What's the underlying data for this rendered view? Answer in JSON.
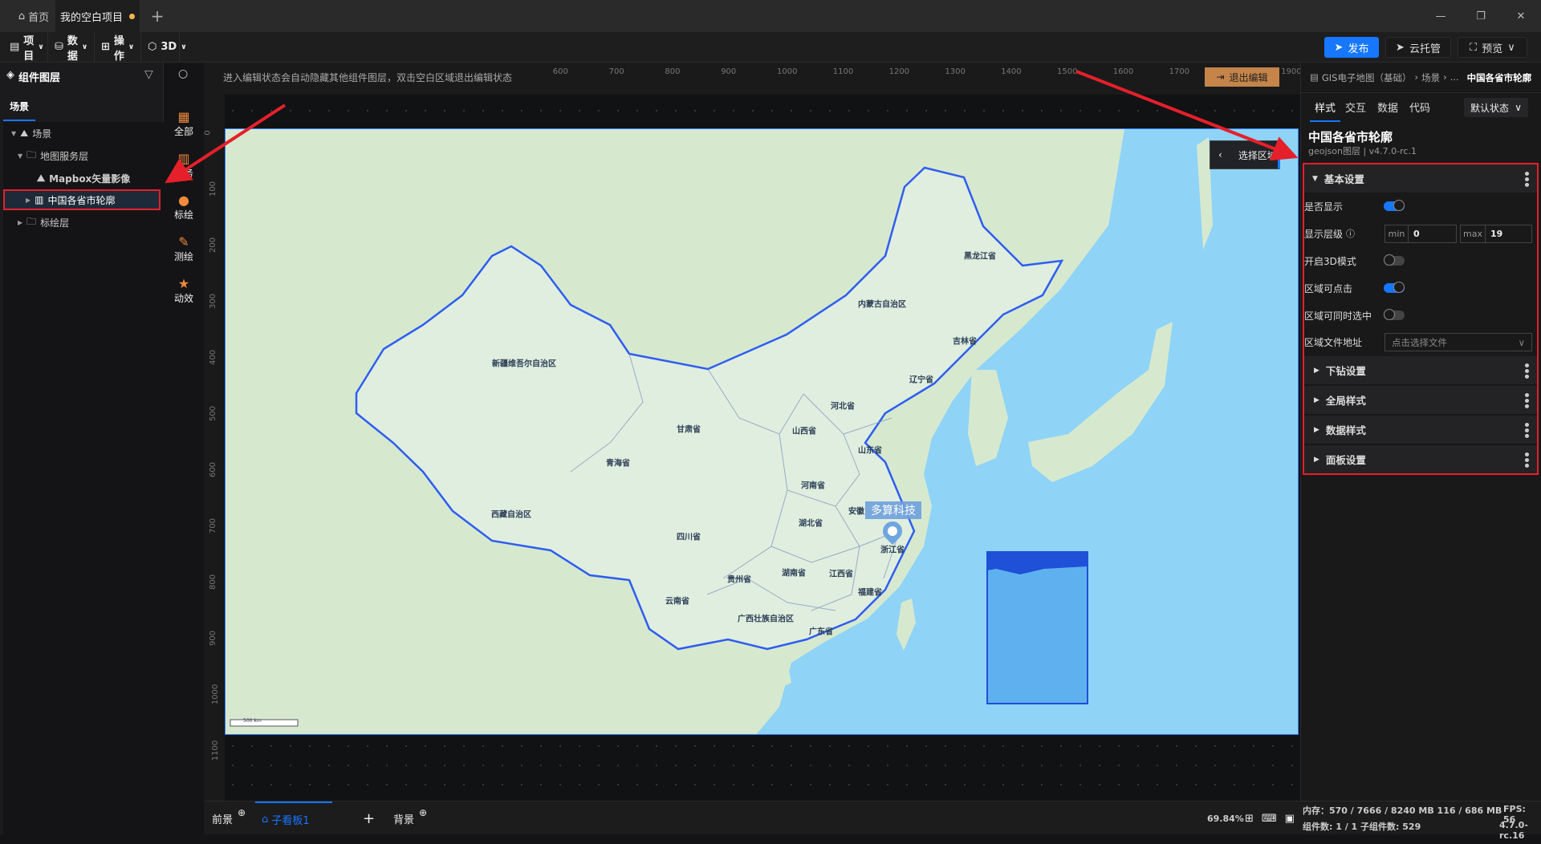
{
  "tabs": {
    "home": "首页",
    "project": "我的空白项目",
    "add": "+"
  },
  "window": {
    "minimize": "—",
    "restore": "❐",
    "close": "✕"
  },
  "toolbar": {
    "items": [
      {
        "label": "项目",
        "icon": "file-icon"
      },
      {
        "label": "数据",
        "icon": "database-icon"
      },
      {
        "label": "操作",
        "icon": "grid-icon"
      },
      {
        "label": "3D",
        "icon": "cube-icon"
      }
    ],
    "publish": "发布",
    "cloud": "云托管",
    "preview": "预览"
  },
  "left": {
    "title": "组件图层",
    "tab": "场景",
    "tree": [
      {
        "label": "场景"
      },
      {
        "label": "地图服务层"
      },
      {
        "label": "Mapbox矢量影像"
      },
      {
        "label": "中国各省市轮廓"
      },
      {
        "label": "标绘层"
      }
    ]
  },
  "iconbar": [
    {
      "label": "全部",
      "icon": "grid-icon"
    },
    {
      "label": "服务",
      "icon": "map-icon"
    },
    {
      "label": "标绘",
      "icon": "pin-icon"
    },
    {
      "label": "测绘",
      "icon": "ruler-pencil-icon"
    },
    {
      "label": "动效",
      "icon": "star-icon"
    }
  ],
  "canvas": {
    "hint": "进入编辑状态会自动隐藏其他组件图层，双击空白区域退出编辑状态",
    "exit_edit": "退出编辑",
    "select_region": "选择区域",
    "ruler_x": [
      "600",
      "700",
      "800",
      "900",
      "1000",
      "1100",
      "1200",
      "1300",
      "1400",
      "1500",
      "1600",
      "1700",
      "1800",
      "1900"
    ],
    "ruler_y": [
      "0",
      "100",
      "200",
      "300",
      "400",
      "500",
      "600",
      "700",
      "800",
      "900",
      "1000",
      "1100"
    ]
  },
  "map": {
    "marker_label": "多算科技",
    "scale": "500 km",
    "provinces": [
      "黑龙江省",
      "内蒙古自治区",
      "吉林省",
      "辽宁省",
      "河北省",
      "新疆维吾尔自治区",
      "甘肃省",
      "山西省",
      "山东省",
      "青海省",
      "河南省",
      "西藏自治区",
      "安徽",
      "湖北省",
      "四川省",
      "浙江省",
      "湖南省",
      "江西省",
      "贵州省",
      "福建省",
      "云南省",
      "广西壮族自治区",
      "广东省"
    ],
    "colors": {
      "ocean": "#8fd3f7",
      "land": "#d8ead0",
      "outline": "#2f5df0"
    }
  },
  "right": {
    "breadcrumb": "GIS电子地图（基础）",
    "crumb2": "场景",
    "ellipsis": "...",
    "current": "中国各省市轮廓",
    "tabs": [
      "样式",
      "交互",
      "数据",
      "代码"
    ],
    "state": "默认状态",
    "title": "中国各省市轮廓",
    "subtitle": "geojson图层 | v4.7.0-rc.1",
    "basic": {
      "header": "基本设置",
      "show": "是否显示",
      "show_on": true,
      "levels": "显示层级",
      "min_label": "min",
      "min": "0",
      "max_label": "max",
      "max": "19",
      "mode3d": "开启3D模式",
      "mode3d_on": false,
      "clickable": "区域可点击",
      "clickable_on": true,
      "multi": "区域可同时选中",
      "multi_on": false,
      "file": "区域文件地址",
      "file_placeholder": "点击选择文件"
    },
    "sections": [
      "下钻设置",
      "全局样式",
      "数据样式",
      "面板设置"
    ]
  },
  "bottom": {
    "front": "前景",
    "board": "子看板1",
    "add": "+",
    "back": "背景",
    "zoom": "69.84%",
    "memory": "内存：570 / 7666 / 8240 MB  116 / 686 MB",
    "fps": "FPS:  56",
    "counts": "组件数: 1 / 1   子组件数: 529",
    "version": "4.7.0-rc.16"
  },
  "accent": "#1677ff"
}
